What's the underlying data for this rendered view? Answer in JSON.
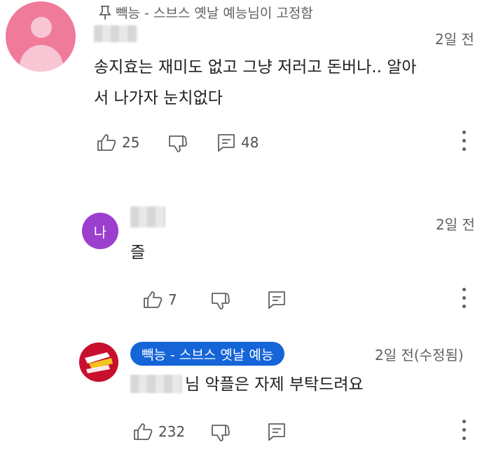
{
  "pinned_label": "빽능 - 스브스 옛날 예능님이 고정함",
  "comment_main": {
    "time": "2일 전",
    "text_line1": "송지효는 재미도 없고 그냥 저러고 돈버나.. 알아",
    "text_line2": "서 나가자 눈치없다",
    "likes": "25",
    "replies": "48"
  },
  "reply_1": {
    "avatar_letter": "나",
    "time": "2일 전",
    "text": "즐",
    "likes": "7"
  },
  "reply_2": {
    "channel_badge": "빽능 - 스브스 옛날 예능",
    "time": "2일 전(수정됨)",
    "text": "님 악플은 자제 부탁드려요",
    "likes": "232"
  },
  "colors": {
    "avatar_pink": "#f07a9a",
    "avatar_purple": "#9c3fcf",
    "badge_blue": "#1565d8",
    "logo_red": "#c8102e"
  }
}
